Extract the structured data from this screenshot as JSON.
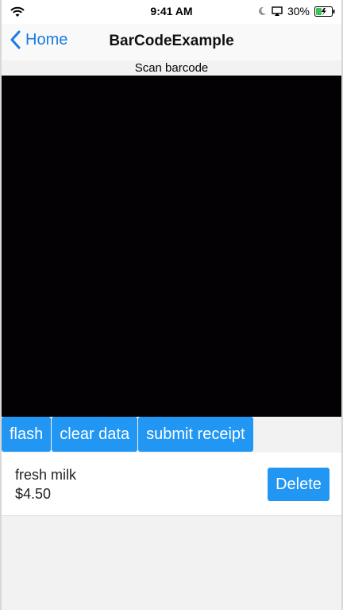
{
  "status_bar": {
    "time": "9:41 AM",
    "battery_percent": "30%",
    "battery_color": "#34c759",
    "icons": [
      "wifi-icon",
      "moon-icon",
      "airplay-icon",
      "battery-icon"
    ]
  },
  "nav": {
    "back_label": "Home",
    "title": "BarCodeExample",
    "accent_color": "#1a7be6"
  },
  "scanner": {
    "label": "Scan barcode"
  },
  "actions": {
    "flash_label": "flash",
    "clear_label": "clear data",
    "submit_label": "submit receipt",
    "button_color": "#2196f3"
  },
  "items": [
    {
      "name": "fresh milk",
      "price": "$4.50",
      "delete_label": "Delete"
    }
  ]
}
